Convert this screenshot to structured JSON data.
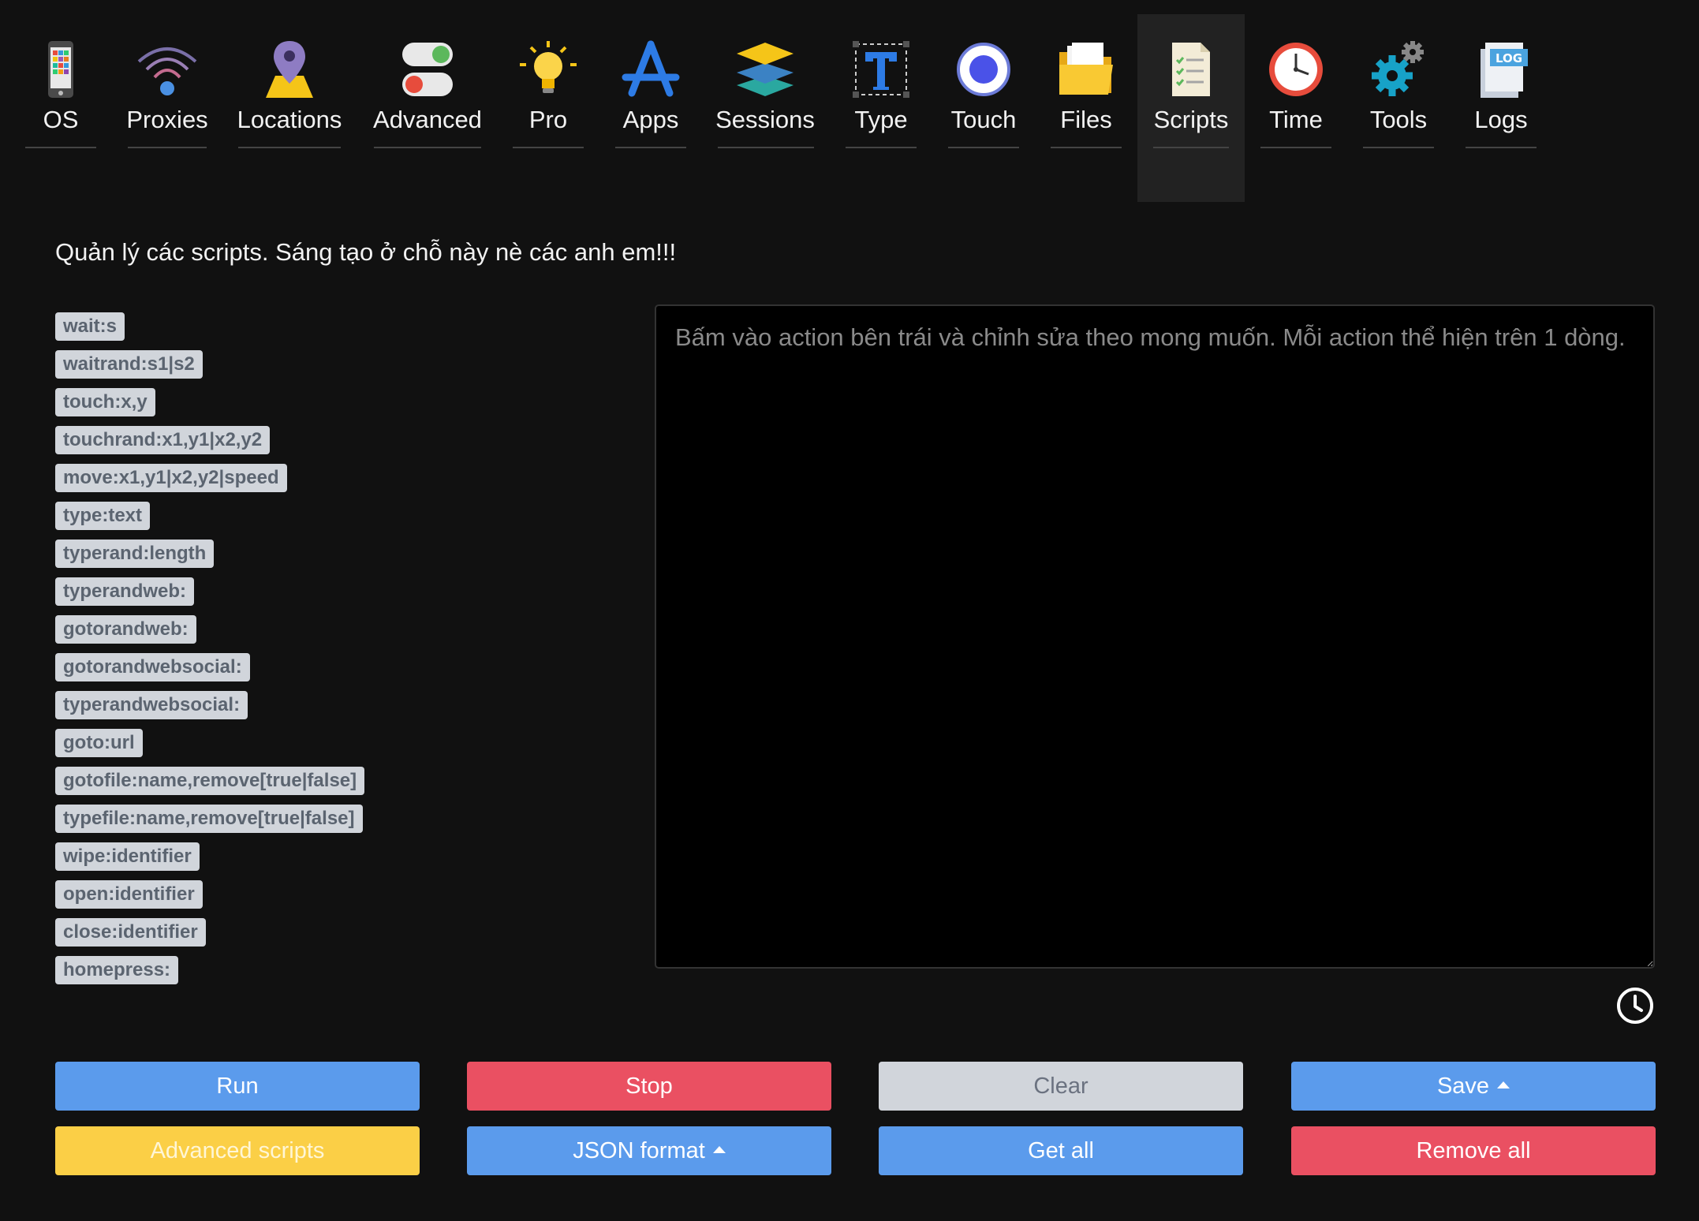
{
  "nav": {
    "items": [
      {
        "label": "OS",
        "icon": "phone-icon"
      },
      {
        "label": "Proxies",
        "icon": "wifi-icon"
      },
      {
        "label": "Locations",
        "icon": "location-pin-icon"
      },
      {
        "label": "Advanced",
        "icon": "toggle-icon"
      },
      {
        "label": "Pro",
        "icon": "lightbulb-icon"
      },
      {
        "label": "Apps",
        "icon": "app-store-icon"
      },
      {
        "label": "Sessions",
        "icon": "layers-icon"
      },
      {
        "label": "Type",
        "icon": "text-type-icon"
      },
      {
        "label": "Touch",
        "icon": "touch-circle-icon"
      },
      {
        "label": "Files",
        "icon": "folder-icon"
      },
      {
        "label": "Scripts",
        "icon": "checklist-document-icon"
      },
      {
        "label": "Time",
        "icon": "clock-icon"
      },
      {
        "label": "Tools",
        "icon": "gears-icon"
      },
      {
        "label": "Logs",
        "icon": "log-file-icon"
      }
    ],
    "active": "Scripts"
  },
  "description": "Quản lý các scripts. Sáng tạo ở chỗ này nè các anh em!!!",
  "actions": [
    "wait:s",
    "waitrand:s1|s2",
    "touch:x,y",
    "touchrand:x1,y1|x2,y2",
    "move:x1,y1|x2,y2|speed",
    "type:text",
    "typerand:length",
    "typerandweb:",
    "gotorandweb:",
    "gotorandwebsocial:",
    "typerandwebsocial:",
    "goto:url",
    "gotofile:name,remove[true|false]",
    "typefile:name,remove[true|false]",
    "wipe:identifier",
    "open:identifier",
    "close:identifier",
    "homepress:"
  ],
  "editor": {
    "placeholder": "Bấm vào action bên trái và chỉnh sửa theo mong muốn. Mỗi action thể hiện trên 1 dòng.",
    "value": ""
  },
  "buttons": {
    "run": "Run",
    "stop": "Stop",
    "clear": "Clear",
    "save": "Save",
    "advanced_scripts": "Advanced scripts",
    "json_format": "JSON format",
    "get_all": "Get all",
    "remove_all": "Remove all"
  },
  "colors": {
    "background": "#111111",
    "active_tab": "#222222",
    "blue": "#5b9bec",
    "red": "#ea5062",
    "gray": "#d1d5db",
    "yellow": "#fbcf46",
    "tag_background": "#d1d5db",
    "tag_text": "#5b6470"
  }
}
